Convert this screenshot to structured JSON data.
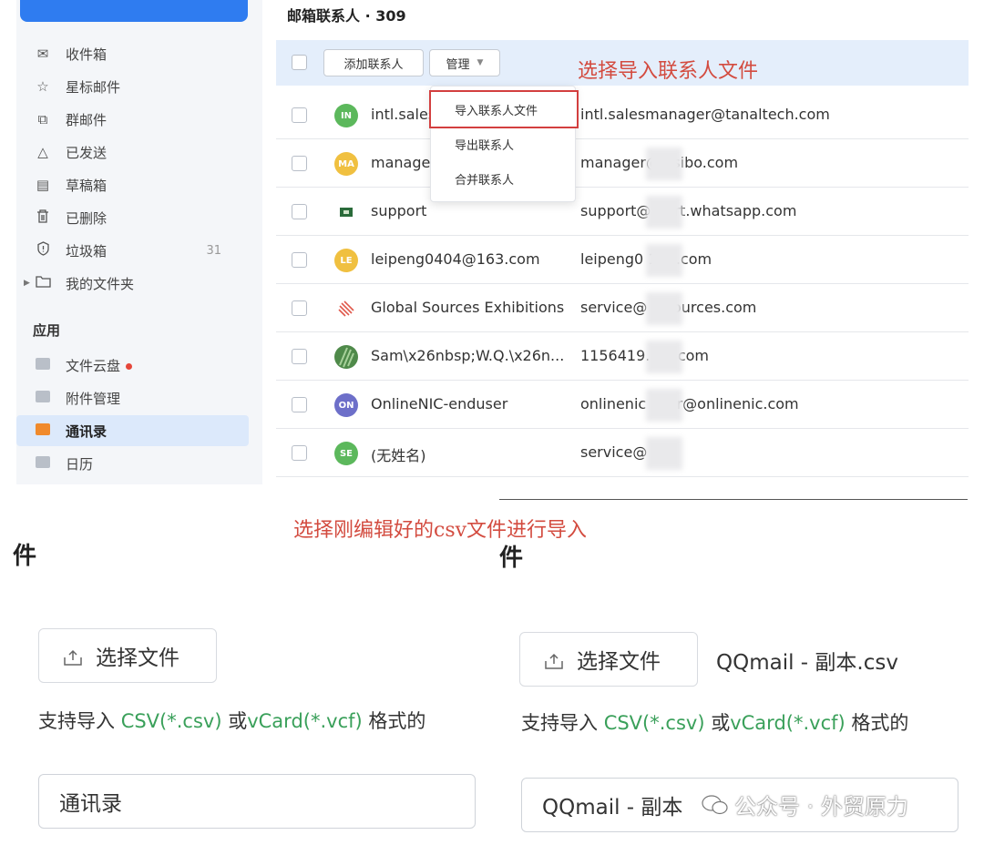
{
  "sidebar": {
    "items": [
      {
        "icon": "inbox-icon",
        "glyph": "✉",
        "label": "收件箱",
        "count": ""
      },
      {
        "icon": "star-icon",
        "glyph": "☆",
        "label": "星标邮件",
        "count": ""
      },
      {
        "icon": "group-mail-icon",
        "glyph": "⧉",
        "label": "群邮件",
        "count": ""
      },
      {
        "icon": "sent-icon",
        "glyph": "△",
        "label": "已发送",
        "count": ""
      },
      {
        "icon": "draft-icon",
        "glyph": "▤",
        "label": "草稿箱",
        "count": ""
      },
      {
        "icon": "trash-icon",
        "glyph": "🗑",
        "label": "已删除",
        "count": ""
      },
      {
        "icon": "spam-icon",
        "glyph": "⊙",
        "label": "垃圾箱",
        "count": "31"
      },
      {
        "icon": "folder-icon",
        "glyph": "▭",
        "label": "我的文件夹",
        "count": ""
      }
    ],
    "apps_title": "应用",
    "apps": [
      {
        "icon": "cloud-drive-icon",
        "label": "文件云盘",
        "dot": true
      },
      {
        "icon": "attachment-manager-icon",
        "label": "附件管理",
        "dot": false
      },
      {
        "icon": "contacts-icon",
        "label": "通讯录",
        "dot": false,
        "active": true
      },
      {
        "icon": "calendar-icon",
        "label": "日历",
        "dot": false
      }
    ]
  },
  "contacts": {
    "title": "邮箱联系人 · 309",
    "add_button": "添加联系人",
    "manage_button": "管理",
    "manage_menu": [
      "导入联系人文件",
      "导出联系人",
      "合并联系人"
    ],
    "rows": [
      {
        "avatar": "IN",
        "color": "#5cb85c",
        "name": "intl.sales",
        "email": "intl.salesmanager@tanaltech.com"
      },
      {
        "avatar": "MA",
        "color": "#f0c040",
        "name": "manage",
        "email": "manager@    ssibo.com"
      },
      {
        "avatar": "",
        "color": "#2a6b3a",
        "name": "support",
        "email": "support@      port.whatsapp.com"
      },
      {
        "avatar": "LE",
        "color": "#f0c040",
        "name": "leipeng0404@163.com",
        "email": "leipeng0       163.com"
      },
      {
        "avatar": "",
        "color": "#e0584b",
        "name": "Global Sources Exhibitions",
        "email": "service@      alsources.com"
      },
      {
        "avatar": "",
        "color": "#4f8a4a",
        "name": "Sam\\x26nbsp;W.Q.\\x26n...",
        "email": "1156419.      qq.com"
      },
      {
        "avatar": "ON",
        "color": "#6d6fc9",
        "name": "OnlineNIC-enduser",
        "email": "onlinenic      user@onlinenic.com"
      },
      {
        "avatar": "SE",
        "color": "#5cb85c",
        "name": "(无姓名)",
        "email": "service@       de"
      }
    ]
  },
  "annotations": {
    "select_import": "选择导入联系人文件",
    "select_csv": "选择刚编辑好的csv文件进行导入"
  },
  "import_left": {
    "title_fragment": "件",
    "choose_button": "选择文件",
    "hint_prefix": "支持导入 ",
    "hint_csv": "CSV(*.csv)",
    "hint_or": " 或",
    "hint_vcard": "vCard(*.vcf)",
    "hint_suffix": " 格式的",
    "group_value": "通讯录"
  },
  "import_right": {
    "title_fragment": "件",
    "choose_button": "选择文件",
    "file_name": "QQmail - 副本.csv",
    "hint_prefix": "支持导入 ",
    "hint_csv": "CSV(*.csv)",
    "hint_or": " 或",
    "hint_vcard": "vCard(*.vcf)",
    "hint_suffix": " 格式的",
    "group_value": "QQmail - 副本"
  },
  "watermark": "公众号 · 外贸原力",
  "colors": {
    "accent": "#2f7cf0",
    "annotation": "#d34b3f",
    "highlight_border": "#d33f3f",
    "link_green": "#3aa05a"
  }
}
